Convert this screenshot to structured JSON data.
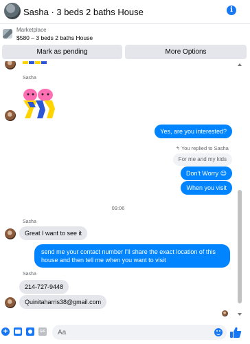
{
  "header": {
    "title": "Sasha · 3 beds 2 baths House",
    "info_icon": "info-icon"
  },
  "listing": {
    "label": "Marketplace",
    "description": "$580 – 3 beds 2 baths House"
  },
  "actions": {
    "mark_pending": "Mark as pending",
    "more_options": "More Options"
  },
  "messages": {
    "sender_1": "Sasha",
    "outgoing_1": "Yes, are you interested?",
    "replied_note": "You replied to Sasha",
    "quoted_text": "For me and my kids",
    "outgoing_2": "Don't Worry 😊",
    "outgoing_3": "When you visit",
    "timestamp": "09:06",
    "sender_2": "Sasha",
    "incoming_1": "Great I want to see it",
    "outgoing_4_line1": "send me your contact number I'll share the exact location of this",
    "outgoing_4_line2": "house and then tell me when you want to visit",
    "sender_3": "Sasha",
    "incoming_2": "214-727-9448",
    "incoming_3": "Quinitaharris38@gmail.com"
  },
  "composer": {
    "placeholder": "Aa",
    "icons": [
      "plus-icon",
      "photo-icon",
      "sticker-icon",
      "gif-icon",
      "emoji-icon",
      "like-icon"
    ]
  },
  "colors": {
    "accent": "#1877f2",
    "outgoing_bubble": "#0084ff",
    "incoming_bubble": "#e4e6eb",
    "button_bg": "#e4e6eb"
  }
}
